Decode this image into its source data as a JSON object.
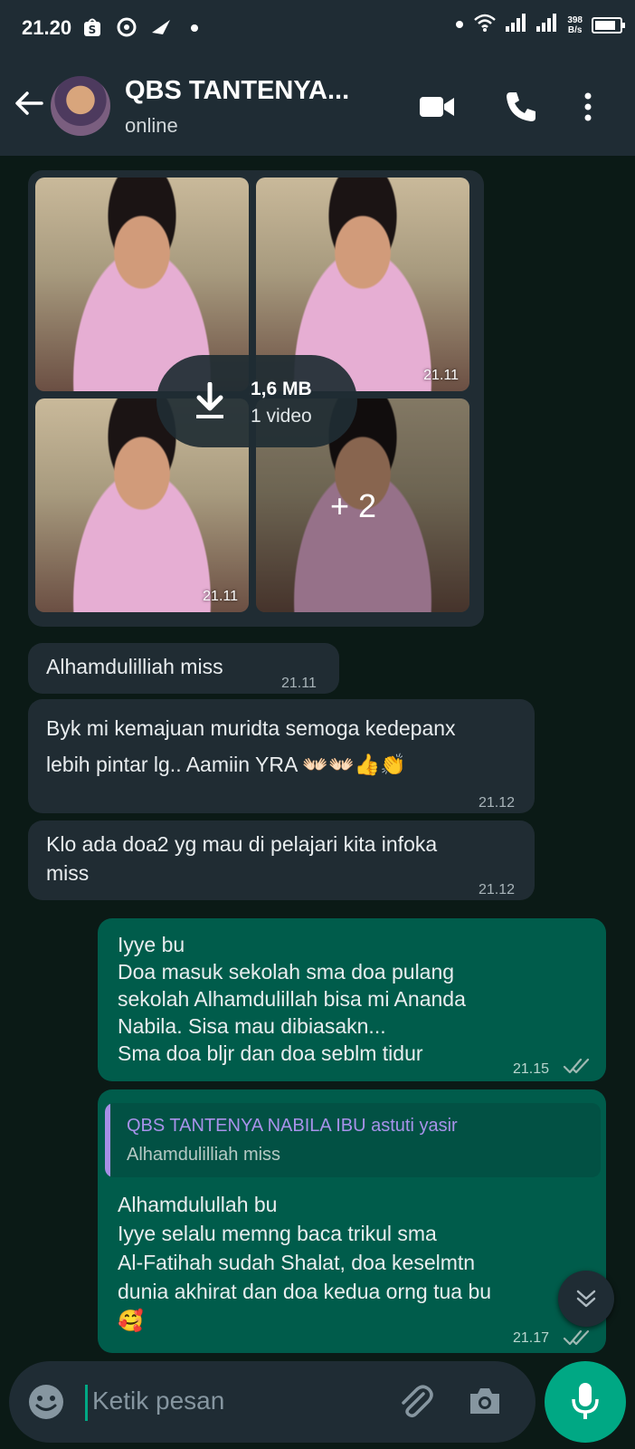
{
  "status_bar": {
    "time": "21.20",
    "speed_value": "398",
    "speed_unit": "B/s",
    "battery_level": 0.85,
    "icons": [
      "shopee-icon",
      "app-icon",
      "bird-icon",
      "dot-icon",
      "wifi-icon",
      "signal-icon",
      "signal-icon",
      "battery-icon"
    ]
  },
  "header": {
    "name": "QBS TANTENYA...",
    "presence": "online"
  },
  "media": {
    "size": "1,6 MB",
    "count": "1 video",
    "more": "+ 2",
    "time_top": "21.11",
    "time_bottom": "21.11"
  },
  "messages": [
    {
      "id": "m1",
      "direction": "in",
      "text": "Alhamdulilliah miss",
      "time": "21.11"
    },
    {
      "id": "m2",
      "direction": "in",
      "lines": [
        "Byk mi kemajuan muridta semoga kedepanx",
        "lebih pintar lg.. Aamiin YRA 👐🏻👐🏻👍👏"
      ],
      "time": "21.12"
    },
    {
      "id": "m3",
      "direction": "in",
      "lines": [
        "Klo ada doa2 yg mau di pelajari kita infoka",
        "miss"
      ],
      "time": "21.12"
    },
    {
      "id": "m4",
      "direction": "out",
      "lines": [
        "Iyye bu",
        "Doa masuk sekolah sma doa pulang",
        "sekolah Alhamdulillah  bisa mi Ananda",
        "Nabila. Sisa mau dibiasakn...",
        "Sma doa bljr dan doa seblm tidur"
      ],
      "time": "21.15"
    },
    {
      "id": "m5",
      "direction": "out",
      "lines": [
        "Alhamdulullah bu",
        "Iyye selalu memng baca trikul sma",
        "Al-Fatihah sudah Shalat, doa keselmtn",
        "dunia akhirat dan doa kedua orng tua bu",
        "🥰"
      ],
      "time": "21.17"
    }
  ],
  "reply_quote": {
    "name": "QBS TANTENYA NABILA IBU astuti yasir",
    "text": "Alhamdulilliah miss"
  },
  "composer": {
    "placeholder": "Ketik pesan"
  },
  "colors": {
    "header_bg": "#1f2c34",
    "chat_bg": "#0b1a16",
    "incoming_bubble": "#202c33",
    "outgoing_bubble": "#005c4b",
    "accent": "#00a884",
    "quote_name": "#a892ea"
  }
}
